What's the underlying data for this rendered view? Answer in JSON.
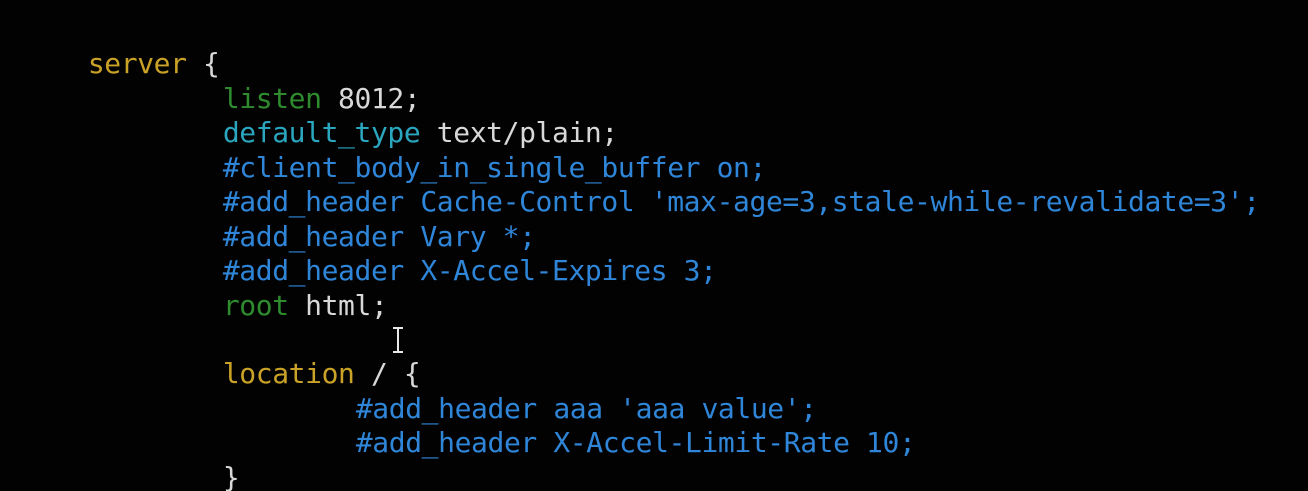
{
  "editor": {
    "lines": {
      "l1": {
        "keyword": "server",
        "rest": " {"
      },
      "l2": {
        "keyword": "listen",
        "rest": " 8012;"
      },
      "l3": {
        "keyword": "default_type",
        "rest": " text/plain;"
      },
      "l4": {
        "comment": "#client_body_in_single_buffer on;"
      },
      "l5": {
        "comment": "#add_header Cache-Control 'max-age=3,stale-while-revalidate=3';"
      },
      "l6": {
        "comment": "#add_header Vary *;"
      },
      "l7": {
        "comment": "#add_header X-Accel-Expires 3;"
      },
      "l8": {
        "keyword": "root",
        "rest": " html;"
      },
      "l9": {
        "keyword": "location",
        "rest": " / {"
      },
      "l10": {
        "comment": "#add_header aaa 'aaa value';"
      },
      "l11": {
        "comment": "#add_header X-Accel-Limit-Rate 10;"
      },
      "l12": {
        "rest": "}"
      }
    },
    "colors": {
      "background": "#020202",
      "keyword_server": "#c9a227",
      "keyword_directive": "#2e8b2e",
      "keyword_type": "#2aa6bf",
      "comment": "#2f86d8",
      "plain": "#d8d8d8"
    },
    "pointer": "text-cursor-icon"
  }
}
